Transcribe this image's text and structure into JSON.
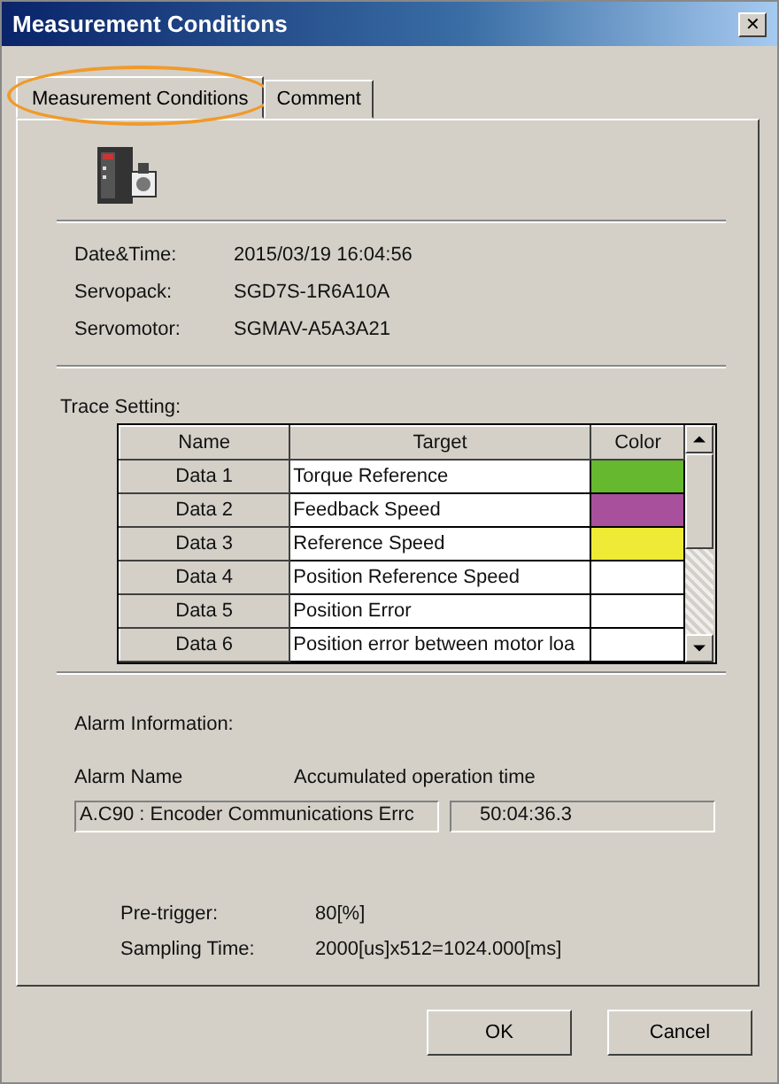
{
  "window": {
    "title": "Measurement Conditions",
    "close": "✕"
  },
  "tabs": [
    {
      "label": "Measurement Conditions",
      "selected": true,
      "highlighted": true
    },
    {
      "label": "Comment",
      "selected": false,
      "highlighted": false
    }
  ],
  "info": [
    {
      "label": "Date&Time:",
      "value": "2015/03/19 16:04:56"
    },
    {
      "label": "Servopack:",
      "value": "SGD7S-1R6A10A"
    },
    {
      "label": "Servomotor:",
      "value": "SGMAV-A5A3A21"
    }
  ],
  "trace": {
    "title": "Trace Setting:",
    "columns": [
      "Name",
      "Target",
      "Color"
    ],
    "rows": [
      {
        "name": "Data 1",
        "target": "Torque Reference",
        "color": "#66b82e"
      },
      {
        "name": "Data 2",
        "target": "Feedback Speed",
        "color": "#a8509c"
      },
      {
        "name": "Data 3",
        "target": "Reference Speed",
        "color": "#eeea36"
      },
      {
        "name": "Data 4",
        "target": "Position Reference Speed",
        "color": "#ffffff"
      },
      {
        "name": "Data 5",
        "target": "Position Error",
        "color": "#ffffff"
      },
      {
        "name": "Data 6",
        "target": "Position error between motor loa",
        "color": "#ffffff"
      }
    ]
  },
  "alarm": {
    "title": "Alarm  Information:",
    "name_label": "Alarm Name",
    "time_label": "Accumulated operation time",
    "name_value": "A.C90 : Encoder Communications Errc",
    "time_value": "50:04:36.3"
  },
  "settings": [
    {
      "label": "Pre-trigger:",
      "value": "80[%]"
    },
    {
      "label": "Sampling Time:",
      "value": "2000[us]x512=1024.000[ms]"
    }
  ],
  "buttons": [
    "OK",
    "Cancel"
  ]
}
